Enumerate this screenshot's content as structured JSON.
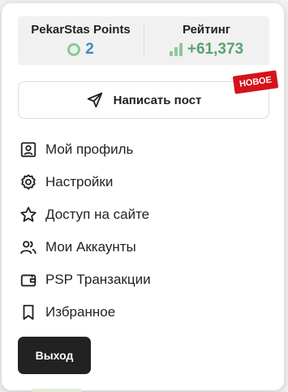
{
  "stats": {
    "points_title": "PekarStas Points",
    "points_value": "2",
    "rating_title": "Рейтинг",
    "rating_value": "+61,373",
    "points_icon": "coin-icon",
    "rating_icon": "bar-chart-icon",
    "points_color": "#3c8fb6",
    "rating_color": "#5aa36a"
  },
  "write_post": {
    "label": "Написать пост",
    "icon": "send-icon",
    "badge": "НОВОЕ",
    "badge_color": "#d5131b"
  },
  "menu": {
    "items": [
      {
        "label": "Мой профиль",
        "icon": "profile-icon"
      },
      {
        "label": "Настройки",
        "icon": "gear-icon"
      },
      {
        "label": "Доступ на сайте",
        "icon": "star-icon"
      },
      {
        "label": "Мои Аккаунты",
        "icon": "users-icon"
      },
      {
        "label": "PSP Транзакции",
        "icon": "wallet-icon"
      },
      {
        "label": "Избранное",
        "icon": "bookmark-icon"
      }
    ]
  },
  "logout": {
    "label": "Выход",
    "color": "#222222"
  }
}
